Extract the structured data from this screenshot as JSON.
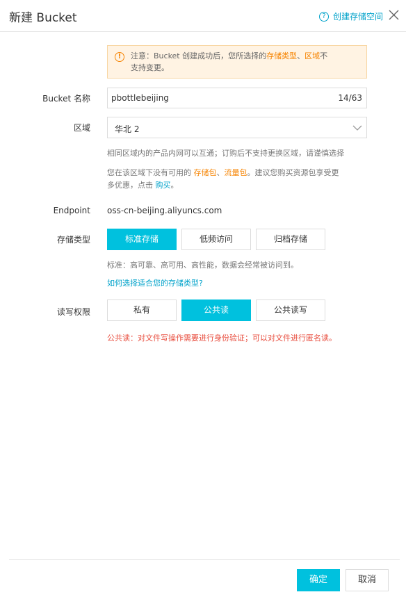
{
  "header": {
    "title": "新建 Bucket",
    "help_label": "创建存储空间",
    "help_icon": "question-circle-icon",
    "close_icon": "close-icon"
  },
  "warning": {
    "prefix": "注意：Bucket 创建成功后，您所选择的",
    "link1": "存储类型",
    "sep": "、",
    "link2": "区域",
    "suffix": "不",
    "line2": "支持变更。"
  },
  "bucket_name": {
    "label": "Bucket 名称",
    "value": "pbottlebeijing",
    "count": "14/63"
  },
  "region": {
    "label": "区域",
    "value": "华北 2",
    "hint1": "相同区域内的产品内网可以互通；订购后不支持更换区域，请谨慎选择",
    "hint2_prefix": "您在该区域下没有可用的 ",
    "hint2_link1": "存储包",
    "hint2_sep": "、",
    "hint2_link2": "流量包",
    "hint2_suffix": "。建议您购买资源包享受更",
    "hint3_prefix": "多优惠，点击 ",
    "hint3_link": "购买",
    "hint3_suffix": "。"
  },
  "endpoint": {
    "label": "Endpoint",
    "value": "oss-cn-beijing.aliyuncs.com"
  },
  "storage_type": {
    "label": "存储类型",
    "options": [
      "标准存储",
      "低频访问",
      "归档存储"
    ],
    "selected": "标准存储",
    "hint": "标准：高可靠、高可用、高性能，数据会经常被访问到。",
    "link": "如何选择适合您的存储类型?"
  },
  "acl": {
    "label": "读写权限",
    "options": [
      "私有",
      "公共读",
      "公共读写"
    ],
    "selected": "公共读",
    "warning": "公共读：对文件写操作需要进行身份验证；可以对文件进行匿名读。"
  },
  "footer": {
    "confirm": "确定",
    "cancel": "取消"
  },
  "colors": {
    "accent": "#00c1de",
    "link": "#00a2ca",
    "warning": "#f68300",
    "error": "#e84c3d"
  }
}
